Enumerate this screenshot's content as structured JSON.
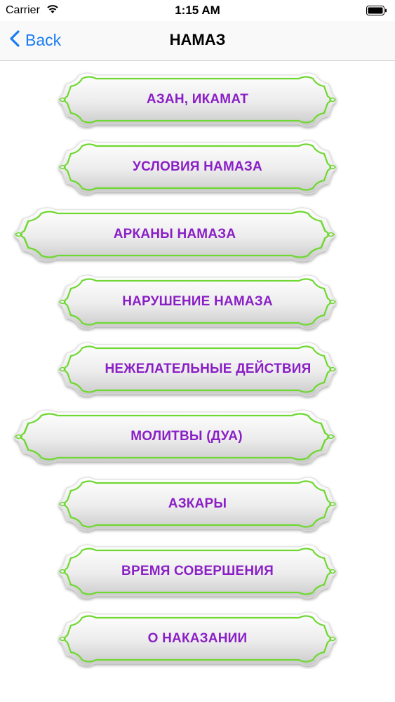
{
  "status_bar": {
    "carrier": "Carrier",
    "time": "1:15 AM",
    "icons": [
      "wifi-icon",
      "battery-icon"
    ]
  },
  "nav": {
    "back_label": "Back",
    "title": "НАМАЗ"
  },
  "menu": {
    "items": [
      {
        "label": "АЗАН, ИКАМАТ"
      },
      {
        "label": "УСЛОВИЯ НАМАЗА"
      },
      {
        "label": "АРКАНЫ НАМАЗА"
      },
      {
        "label": "НАРУШЕНИЕ НАМАЗА"
      },
      {
        "label": "НЕЖЕЛАТЕЛЬНЫЕ ДЕЙСТВИЯ"
      },
      {
        "label": "МОЛИТВЫ (ДУА)"
      },
      {
        "label": "АЗКАРЫ"
      },
      {
        "label": "ВРЕМЯ СОВЕРШЕНИЯ"
      },
      {
        "label": "О НАКАЗАНИИ"
      }
    ]
  },
  "colors": {
    "accent": "#1a7cf5",
    "label": "#8a1fc6",
    "border": "#6fd832",
    "button_fill": "#e6e6e6"
  }
}
